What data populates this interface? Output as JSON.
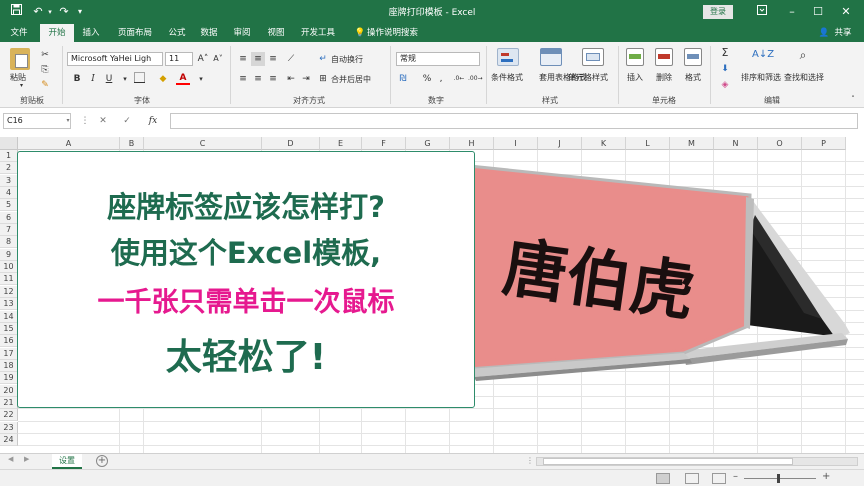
{
  "window": {
    "title": "座牌打印模板 - Excel",
    "login_label": "登录",
    "controls": [
      "min",
      "restore",
      "close"
    ]
  },
  "tabs": [
    "文件",
    "开始",
    "插入",
    "页面布局",
    "公式",
    "数据",
    "审阅",
    "视图",
    "开发工具"
  ],
  "active_tab": "开始",
  "tell_me": "操作说明搜索",
  "share": "共享",
  "ribbon": {
    "clipboard": {
      "paste": "粘贴",
      "group": "剪贴板"
    },
    "font": {
      "name": "Microsoft YaHei Ligh",
      "size": "11",
      "bold": "B",
      "italic": "I",
      "underline": "U",
      "group": "字体"
    },
    "alignment": {
      "wrap": "自动换行",
      "merge": "合并后居中",
      "group": "对齐方式"
    },
    "number": {
      "format": "常规",
      "group": "数字"
    },
    "styles": {
      "conditional": "条件格式",
      "table": "套用表格格式",
      "cell": "单元格样式",
      "group": "样式"
    },
    "cells": {
      "insert": "插入",
      "delete": "删除",
      "format": "格式",
      "group": "单元格"
    },
    "editing": {
      "sort": "排序和筛选",
      "find": "查找和选择",
      "group": "编辑"
    }
  },
  "formula_bar": {
    "name_box": "C16",
    "fx": "fx",
    "value": ""
  },
  "columns": [
    "A",
    "B",
    "C",
    "D",
    "E",
    "F",
    "G",
    "H",
    "I",
    "J",
    "K",
    "L",
    "M",
    "N",
    "O",
    "P"
  ],
  "rows": [
    "1",
    "2",
    "3",
    "4",
    "5",
    "6",
    "7",
    "8",
    "9",
    "10",
    "11",
    "12",
    "13",
    "14",
    "15",
    "16",
    "17",
    "18",
    "19",
    "20",
    "21",
    "22",
    "23",
    "24"
  ],
  "textbox": {
    "line1": "座牌标签应该怎样打?",
    "line2": "使用这个Excel模板,",
    "line3": "一千张只需单击一次鼠标",
    "line4": "太轻松了!",
    "colors": {
      "green": "#1e6b4f",
      "magenta": "#e6198f"
    }
  },
  "sign": {
    "name_text": "唐伯虎",
    "plate_color": "#e98d8b"
  },
  "sheet": {
    "tab_label": "设置"
  },
  "colors": {
    "accent": "#217346"
  }
}
